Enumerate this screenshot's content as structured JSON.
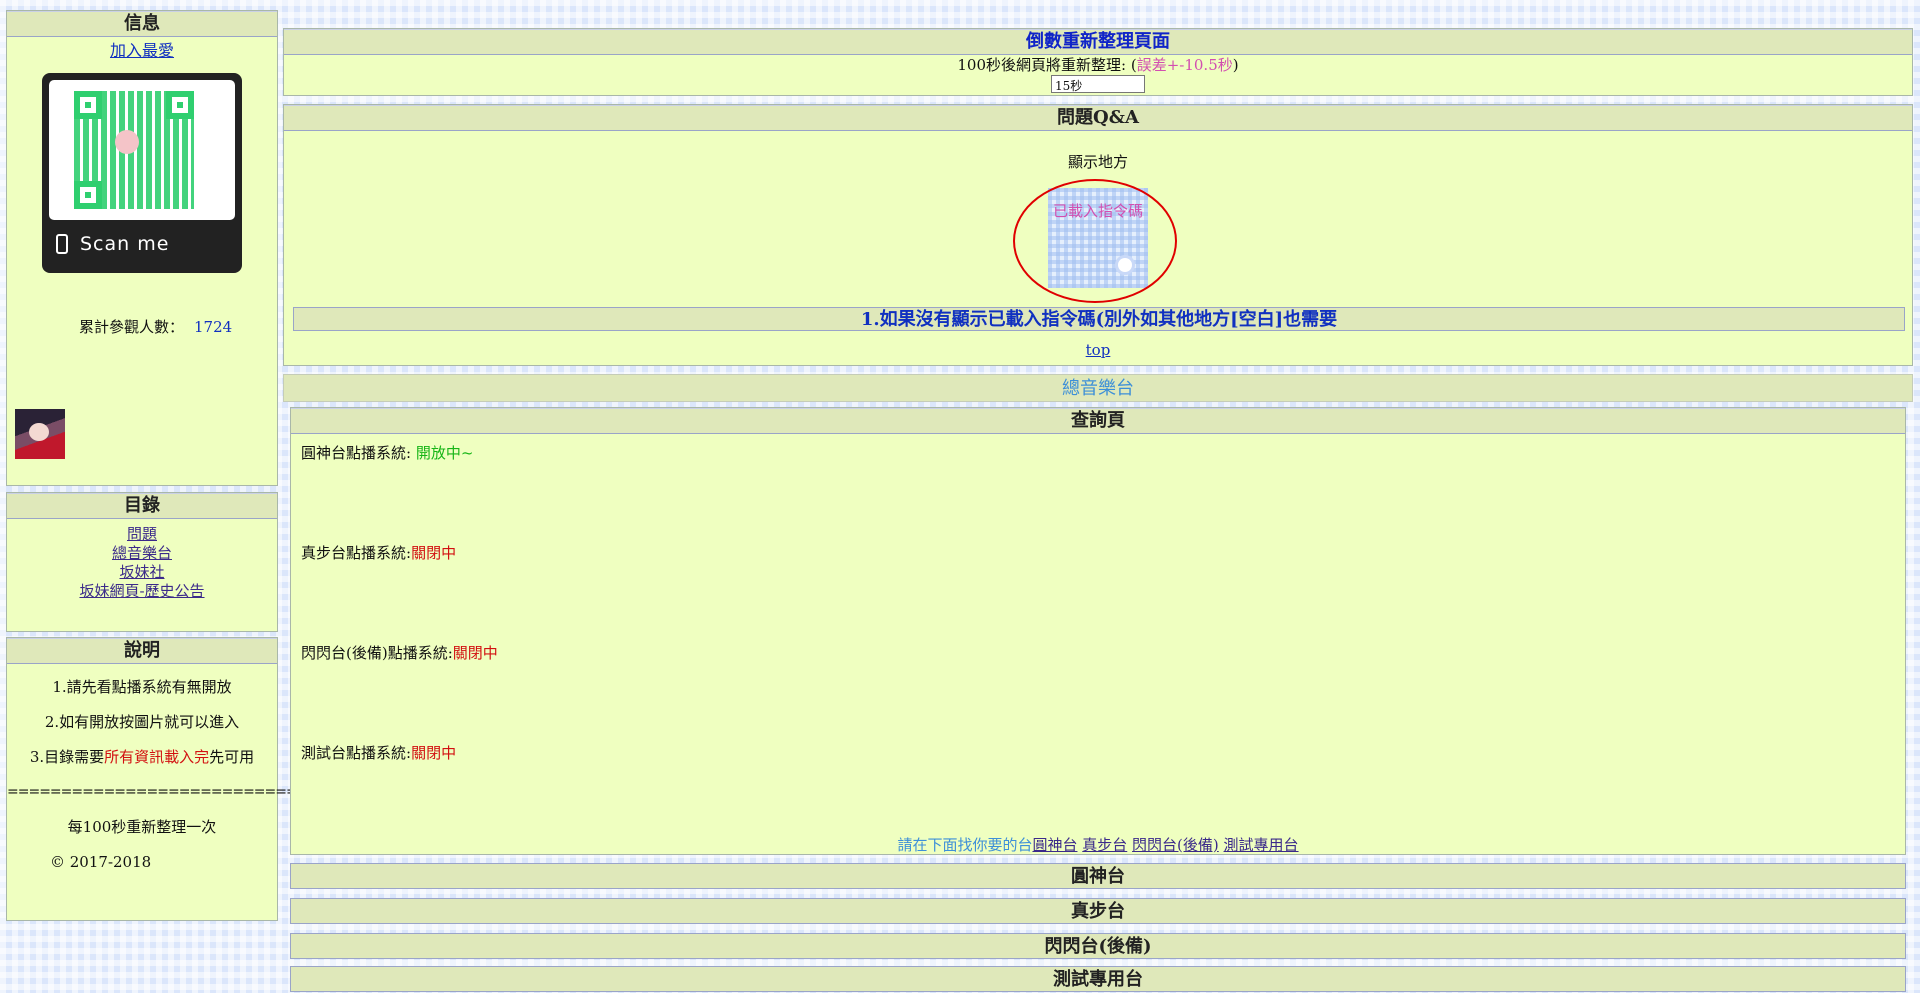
{
  "sidebar": {
    "info": {
      "title": "信息",
      "add_favorite": "加入最愛",
      "qr_caption": "Scan me",
      "visits_label": "累計參觀人數：",
      "visits_count": "1724"
    },
    "toc": {
      "title": "目錄",
      "items": [
        "問題",
        "總音樂台",
        "坂妹社",
        "坂妹網頁-歷史公告"
      ]
    },
    "description": {
      "title": "說明",
      "line1": "1.請先看點播系統有無開放",
      "line2": "2.如有開放按圖片就可以進入",
      "line3_pre": "3.目錄需要",
      "line3_red": "所有資訊載入完",
      "line3_post": "先可用",
      "rule": "==============================",
      "refresh_note": "每100秒重新整理一次",
      "copyright": "© 2017-2018"
    }
  },
  "refresh": {
    "title": "倒數重新整理頁面",
    "text_pre": "100秒後網頁將重新整理: (",
    "text_pink": "誤差+-10.5秒",
    "text_post": ")",
    "countdown_value": "15秒"
  },
  "qa": {
    "title": "問題Q&A",
    "display_label": "顯示地方",
    "loaded_text": "已載入指令碼",
    "note": "1.如果沒有顯示已載入指令碼(別外如其他地方[空白]也需要",
    "top_link": "top"
  },
  "radio": {
    "title": "總音樂台",
    "query_title": "查詢頁",
    "systems": [
      {
        "label": "圓神台點播系統: ",
        "status": "開放中~",
        "status_color": "#16b516"
      },
      {
        "label": "真步台點播系統:",
        "status": "關閉中",
        "status_color": "#d21010"
      },
      {
        "label": "閃閃台(後備)點播系統:",
        "status": "關閉中",
        "status_color": "#d21010"
      },
      {
        "label": "測試台點播系統:",
        "status": "關閉中",
        "status_color": "#d21010"
      }
    ],
    "hint_lead": "請在下面找你要的台",
    "hint_links": [
      "圓神台",
      "真步台",
      "閃閃台(後備)",
      "測試專用台"
    ],
    "sections": [
      "圓神台",
      "真步台",
      "閃閃台(後備)",
      "測試專用台"
    ]
  }
}
